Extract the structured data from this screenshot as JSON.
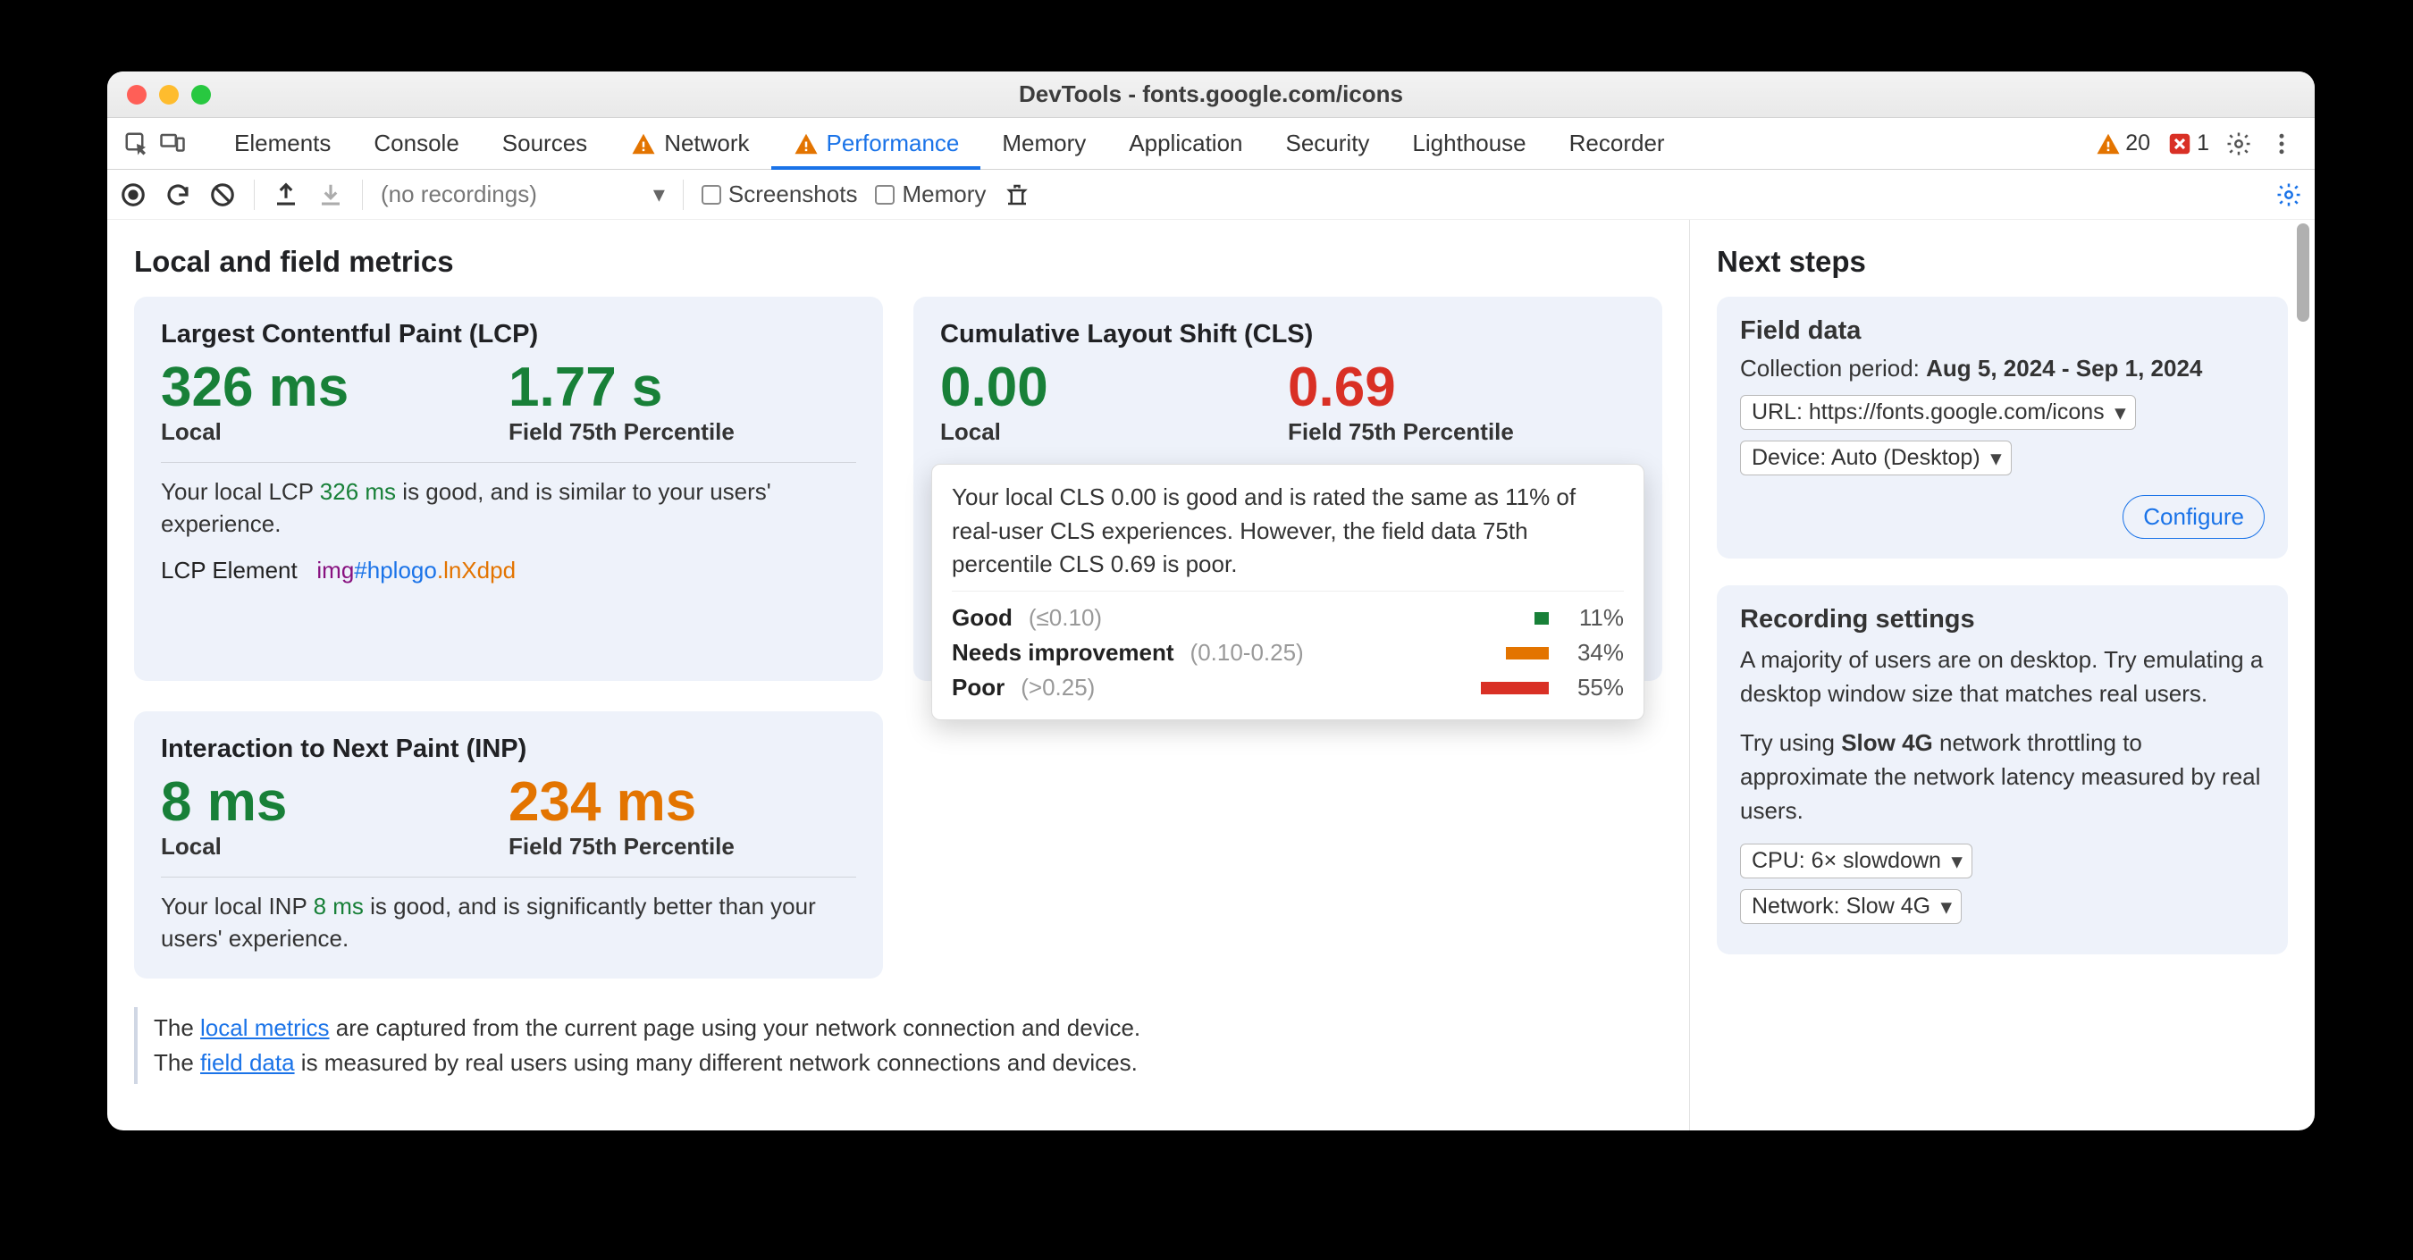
{
  "window": {
    "title": "DevTools - fonts.google.com/icons"
  },
  "tabs": {
    "items": [
      "Elements",
      "Console",
      "Sources",
      "Network",
      "Performance",
      "Memory",
      "Application",
      "Security",
      "Lighthouse",
      "Recorder"
    ],
    "active": "Performance",
    "warnTabs": [
      "Network",
      "Performance"
    ],
    "issueCounts": {
      "warnings": "20",
      "errors": "1"
    }
  },
  "toolbar": {
    "recordings": "(no recordings)",
    "screenshots_label": "Screenshots",
    "memory_label": "Memory"
  },
  "main": {
    "heading": "Local and field metrics",
    "lcp": {
      "title": "Largest Contentful Paint (LCP)",
      "local_value": "326 ms",
      "local_label": "Local",
      "field_value": "1.77 s",
      "field_label": "Field 75th Percentile",
      "desc_pre": "Your local LCP ",
      "desc_val": "326 ms",
      "desc_post": " is good, and is similar to your users' experience.",
      "el_label": "LCP Element",
      "el_tag": "img",
      "el_id": "#hplogo",
      "el_cls": ".lnXdpd"
    },
    "cls": {
      "title": "Cumulative Layout Shift (CLS)",
      "local_value": "0.00",
      "local_label": "Local",
      "field_value": "0.69",
      "field_label": "Field 75th Percentile",
      "tip_body_1": "Your local CLS ",
      "tip_body_v1": "0.00",
      "tip_body_2": " is good and is rated the same as 11% of real-user CLS experiences. However, the field data 75th percentile CLS ",
      "tip_body_v2": "0.69",
      "tip_body_3": " is poor.",
      "buckets": {
        "good": {
          "name": "Good",
          "range": "(≤0.10)",
          "pct": "11%"
        },
        "ni": {
          "name": "Needs improvement",
          "range": "(0.10-0.25)",
          "pct": "34%"
        },
        "poor": {
          "name": "Poor",
          "range": "(>0.25)",
          "pct": "55%"
        }
      }
    },
    "inp": {
      "title": "Interaction to Next Paint (INP)",
      "local_value": "8 ms",
      "local_label": "Local",
      "field_value": "234 ms",
      "field_label": "Field 75th Percentile",
      "desc_pre": "Your local INP ",
      "desc_val": "8 ms",
      "desc_post": " is good, and is significantly better than your users' experience."
    },
    "footer": {
      "l1a": "The ",
      "l1link": "local metrics",
      "l1b": " are captured from the current page using your network connection and device.",
      "l2a": "The ",
      "l2link": "field data",
      "l2b": " is measured by real users using many different network connections and devices."
    }
  },
  "sidebar": {
    "heading": "Next steps",
    "field": {
      "title": "Field data",
      "period_label": "Collection period: ",
      "period_value": "Aug 5, 2024 - Sep 1, 2024",
      "url_select": "URL: https://fonts.google.com/icons",
      "device_select": "Device: Auto (Desktop)",
      "configure": "Configure"
    },
    "rec": {
      "title": "Recording settings",
      "p1": "A majority of users are on desktop. Try emulating a desktop window size that matches real users.",
      "p2a": "Try using ",
      "p2b": "Slow 4G",
      "p2c": " network throttling to approximate the network latency measured by real users.",
      "cpu_select": "CPU: 6× slowdown",
      "net_select": "Network: Slow 4G"
    }
  }
}
